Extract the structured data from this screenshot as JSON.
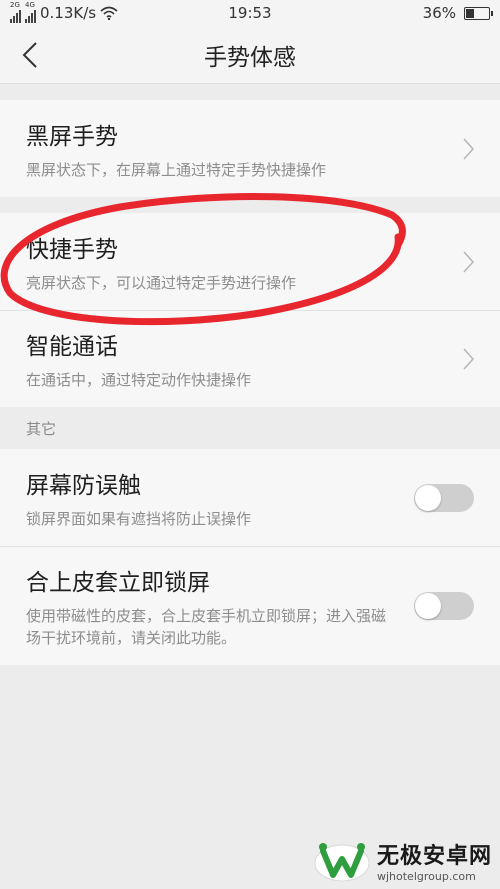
{
  "status_bar": {
    "signal_tag_1": "2G",
    "signal_tag_2": "4G",
    "net_speed": "0.13K/s",
    "time": "19:53",
    "battery_percent": "36%",
    "battery_level": 0.36
  },
  "header": {
    "title": "手势体感"
  },
  "groups": [
    {
      "items": [
        {
          "title": "黑屏手势",
          "subtitle": "黑屏状态下，在屏幕上通过特定手势快捷操作",
          "control": "chevron"
        }
      ]
    },
    {
      "items": [
        {
          "title": "快捷手势",
          "subtitle": "亮屏状态下，可以通过特定手势进行操作",
          "control": "chevron"
        },
        {
          "title": "智能通话",
          "subtitle": "在通话中，通过特定动作快捷操作",
          "control": "chevron"
        }
      ]
    }
  ],
  "other_section": {
    "label": "其它",
    "items": [
      {
        "title": "屏幕防误触",
        "subtitle": "锁屏界面如果有遮挡将防止误操作",
        "control": "toggle",
        "on": false
      },
      {
        "title": "合上皮套立即锁屏",
        "subtitle": "使用带磁性的皮套，合上皮套手机立即锁屏；进入强磁场干扰环境前，请关闭此功能。",
        "control": "toggle",
        "on": false
      }
    ]
  },
  "annotation": {
    "color": "#e8262e"
  },
  "watermark": {
    "name": "无极安卓网",
    "url": "wjhotelgroup.com"
  },
  "colors": {
    "accent_green": "#2e9e3e",
    "annotation_red": "#e8262e"
  }
}
